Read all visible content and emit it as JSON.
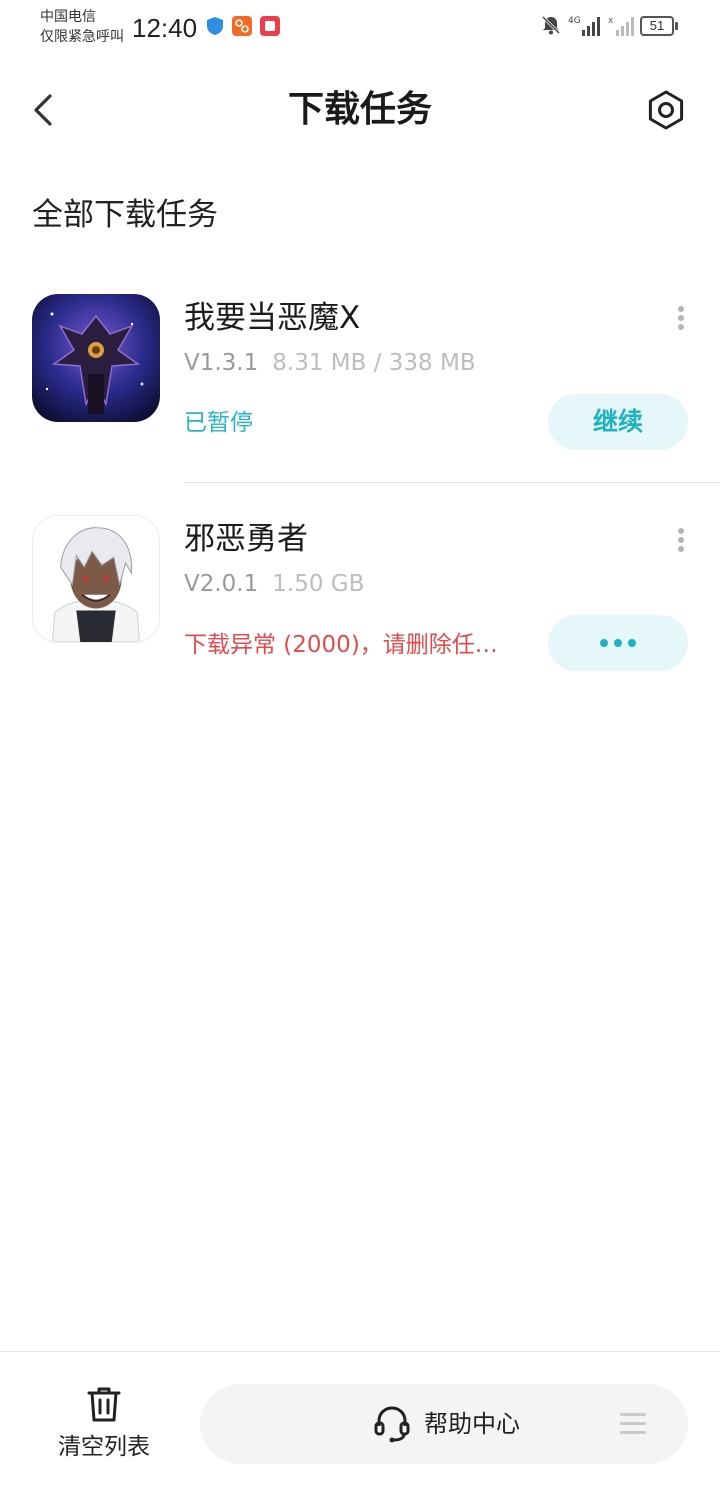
{
  "status_bar": {
    "carrier_line1": "中国电信",
    "carrier_line2": "仅限紧急呼叫",
    "time": "12:40",
    "battery": "51"
  },
  "header": {
    "title": "下载任务",
    "back_icon": "chevron-left-icon",
    "settings_icon": "settings-hexagon-icon"
  },
  "section_title": "全部下载任务",
  "items": [
    {
      "name": "我要当恶魔X",
      "version": "V1.3.1",
      "size": "8.31 MB / 338 MB",
      "status": "已暂停",
      "action_label": "继续"
    },
    {
      "name": "邪恶勇者",
      "version": "V2.0.1",
      "size": "1.50 GB",
      "status": "下载异常 (2000)，请删除任…",
      "action_label": "•••"
    }
  ],
  "bottom": {
    "clear_label": "清空列表",
    "help_label": "帮助中心"
  },
  "colors": {
    "accent": "#1fb3c2",
    "error": "#e24b4b",
    "button_bg": "#e5f7f9"
  }
}
